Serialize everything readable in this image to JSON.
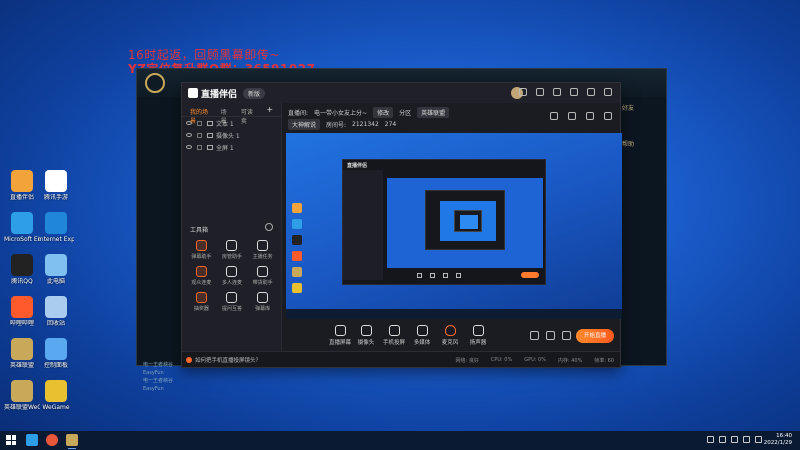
{
  "overlay": {
    "line1": "16时起返，回顾黑幕即传~",
    "line2": "YZ定位复升群Q群：36591027"
  },
  "desktop_icons": [
    {
      "label": "直播伴侣",
      "color": "#f2a33a"
    },
    {
      "label": "腾讯手游",
      "color": "#ffffff"
    },
    {
      "label": "MicroSoft Edge",
      "color": "#2f9ee8"
    },
    {
      "label": "Internet Explorer",
      "color": "#1f86d8"
    },
    {
      "label": "腾讯QQ",
      "color": "#222222"
    },
    {
      "label": "此电脑",
      "color": "#7fc0f0"
    },
    {
      "label": "哔哩哔哩",
      "color": "#ff5a2c"
    },
    {
      "label": "回收站",
      "color": "#aaccee"
    },
    {
      "label": "英雄联盟",
      "color": "#c8a95a"
    },
    {
      "label": "控制面板",
      "color": "#5aa8f0"
    },
    {
      "label": "英雄联盟WeGame",
      "color": "#c8a95a"
    },
    {
      "label": "WeGame",
      "color": "#e8c030"
    }
  ],
  "lol_window": {
    "right_items": [
      "好友",
      "",
      "帮助",
      "",
      ""
    ],
    "chat_lines": [
      "电一王者峡谷",
      "EasyFun",
      "电一王者峡谷",
      "EasyFun"
    ]
  },
  "app": {
    "logo_text": "直播伴侣",
    "version_badge": "新版",
    "left_tabs": [
      "我的场景",
      "场景",
      "可读卖"
    ],
    "add_label": "+",
    "sources": [
      {
        "name": "文本 1"
      },
      {
        "name": "摄像头 1"
      },
      {
        "name": "全屏 1"
      }
    ],
    "toolbox_title": "工具箱",
    "tools": [
      {
        "label": "弹幕助手",
        "orange": true
      },
      {
        "label": "房管助手",
        "orange": false
      },
      {
        "label": "主播任务",
        "orange": false
      },
      {
        "label": "观众连麦",
        "orange": true
      },
      {
        "label": "多人连麦",
        "orange": false
      },
      {
        "label": "带货助手",
        "orange": false
      },
      {
        "label": "抽奖器",
        "orange": true
      },
      {
        "label": "提问互答",
        "orange": false
      },
      {
        "label": "弹幕库",
        "orange": false
      }
    ],
    "info": {
      "title_label": "直播间:",
      "title_value": "电一带小女友上分~",
      "edit_btn": "修改",
      "category_label": "分区",
      "category_value": "英雄联盟",
      "tag_value": "大神解说",
      "room_label": "房间号:",
      "room_id": "2121342",
      "fans": "274"
    },
    "preview": {
      "nested_title": "直播伴侣",
      "icon_colors": [
        "#f2a33a",
        "#2f9ee8",
        "#222222",
        "#ff5a2c",
        "#c8a95a",
        "#e8c030"
      ]
    },
    "controls": [
      {
        "label": "直播屏幕"
      },
      {
        "label": "摄像头"
      },
      {
        "label": "手机投屏"
      },
      {
        "label": "多媒体"
      },
      {
        "label": "麦克风"
      },
      {
        "label": "扬声器"
      }
    ],
    "start_button": "开始直播",
    "status": {
      "tip": "如何把手机直播投屏镜头？",
      "stats": [
        "网络: 良好",
        "CPU: 0%",
        "GPU: 0%",
        "内存: 40%",
        "帧率: 60"
      ]
    }
  },
  "taskbar": {
    "time": "16:40",
    "date": "2022/1/29"
  }
}
